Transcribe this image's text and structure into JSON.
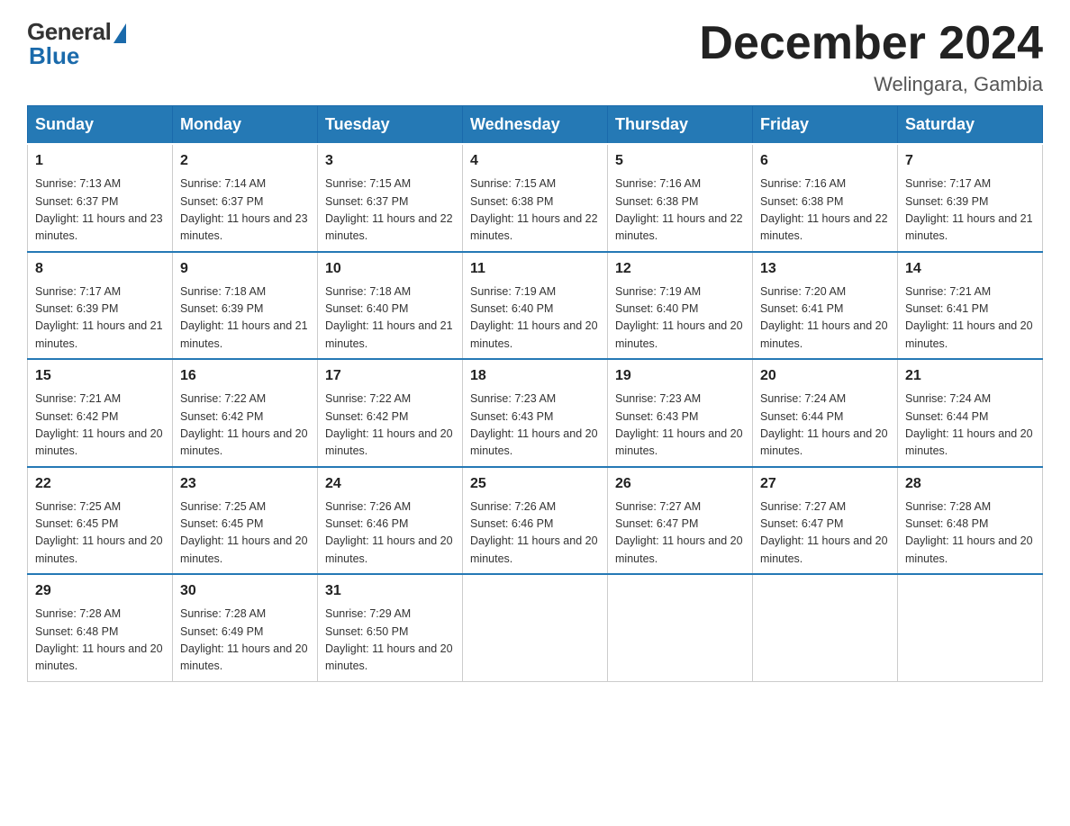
{
  "logo": {
    "general_text": "General",
    "blue_text": "Blue"
  },
  "header": {
    "month_title": "December 2024",
    "location": "Welingara, Gambia"
  },
  "days_of_week": [
    "Sunday",
    "Monday",
    "Tuesday",
    "Wednesday",
    "Thursday",
    "Friday",
    "Saturday"
  ],
  "weeks": [
    [
      {
        "day": "1",
        "sunrise": "7:13 AM",
        "sunset": "6:37 PM",
        "daylight": "11 hours and 23 minutes."
      },
      {
        "day": "2",
        "sunrise": "7:14 AM",
        "sunset": "6:37 PM",
        "daylight": "11 hours and 23 minutes."
      },
      {
        "day": "3",
        "sunrise": "7:15 AM",
        "sunset": "6:37 PM",
        "daylight": "11 hours and 22 minutes."
      },
      {
        "day": "4",
        "sunrise": "7:15 AM",
        "sunset": "6:38 PM",
        "daylight": "11 hours and 22 minutes."
      },
      {
        "day": "5",
        "sunrise": "7:16 AM",
        "sunset": "6:38 PM",
        "daylight": "11 hours and 22 minutes."
      },
      {
        "day": "6",
        "sunrise": "7:16 AM",
        "sunset": "6:38 PM",
        "daylight": "11 hours and 22 minutes."
      },
      {
        "day": "7",
        "sunrise": "7:17 AM",
        "sunset": "6:39 PM",
        "daylight": "11 hours and 21 minutes."
      }
    ],
    [
      {
        "day": "8",
        "sunrise": "7:17 AM",
        "sunset": "6:39 PM",
        "daylight": "11 hours and 21 minutes."
      },
      {
        "day": "9",
        "sunrise": "7:18 AM",
        "sunset": "6:39 PM",
        "daylight": "11 hours and 21 minutes."
      },
      {
        "day": "10",
        "sunrise": "7:18 AM",
        "sunset": "6:40 PM",
        "daylight": "11 hours and 21 minutes."
      },
      {
        "day": "11",
        "sunrise": "7:19 AM",
        "sunset": "6:40 PM",
        "daylight": "11 hours and 20 minutes."
      },
      {
        "day": "12",
        "sunrise": "7:19 AM",
        "sunset": "6:40 PM",
        "daylight": "11 hours and 20 minutes."
      },
      {
        "day": "13",
        "sunrise": "7:20 AM",
        "sunset": "6:41 PM",
        "daylight": "11 hours and 20 minutes."
      },
      {
        "day": "14",
        "sunrise": "7:21 AM",
        "sunset": "6:41 PM",
        "daylight": "11 hours and 20 minutes."
      }
    ],
    [
      {
        "day": "15",
        "sunrise": "7:21 AM",
        "sunset": "6:42 PM",
        "daylight": "11 hours and 20 minutes."
      },
      {
        "day": "16",
        "sunrise": "7:22 AM",
        "sunset": "6:42 PM",
        "daylight": "11 hours and 20 minutes."
      },
      {
        "day": "17",
        "sunrise": "7:22 AM",
        "sunset": "6:42 PM",
        "daylight": "11 hours and 20 minutes."
      },
      {
        "day": "18",
        "sunrise": "7:23 AM",
        "sunset": "6:43 PM",
        "daylight": "11 hours and 20 minutes."
      },
      {
        "day": "19",
        "sunrise": "7:23 AM",
        "sunset": "6:43 PM",
        "daylight": "11 hours and 20 minutes."
      },
      {
        "day": "20",
        "sunrise": "7:24 AM",
        "sunset": "6:44 PM",
        "daylight": "11 hours and 20 minutes."
      },
      {
        "day": "21",
        "sunrise": "7:24 AM",
        "sunset": "6:44 PM",
        "daylight": "11 hours and 20 minutes."
      }
    ],
    [
      {
        "day": "22",
        "sunrise": "7:25 AM",
        "sunset": "6:45 PM",
        "daylight": "11 hours and 20 minutes."
      },
      {
        "day": "23",
        "sunrise": "7:25 AM",
        "sunset": "6:45 PM",
        "daylight": "11 hours and 20 minutes."
      },
      {
        "day": "24",
        "sunrise": "7:26 AM",
        "sunset": "6:46 PM",
        "daylight": "11 hours and 20 minutes."
      },
      {
        "day": "25",
        "sunrise": "7:26 AM",
        "sunset": "6:46 PM",
        "daylight": "11 hours and 20 minutes."
      },
      {
        "day": "26",
        "sunrise": "7:27 AM",
        "sunset": "6:47 PM",
        "daylight": "11 hours and 20 minutes."
      },
      {
        "day": "27",
        "sunrise": "7:27 AM",
        "sunset": "6:47 PM",
        "daylight": "11 hours and 20 minutes."
      },
      {
        "day": "28",
        "sunrise": "7:28 AM",
        "sunset": "6:48 PM",
        "daylight": "11 hours and 20 minutes."
      }
    ],
    [
      {
        "day": "29",
        "sunrise": "7:28 AM",
        "sunset": "6:48 PM",
        "daylight": "11 hours and 20 minutes."
      },
      {
        "day": "30",
        "sunrise": "7:28 AM",
        "sunset": "6:49 PM",
        "daylight": "11 hours and 20 minutes."
      },
      {
        "day": "31",
        "sunrise": "7:29 AM",
        "sunset": "6:50 PM",
        "daylight": "11 hours and 20 minutes."
      },
      null,
      null,
      null,
      null
    ]
  ]
}
